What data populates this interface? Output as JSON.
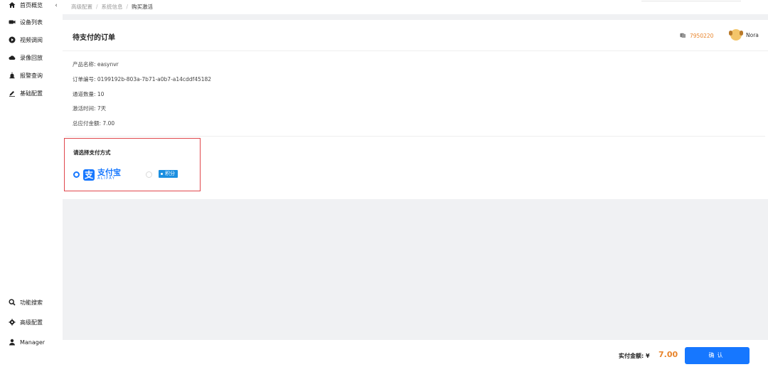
{
  "sidebar": {
    "collapse_icon": "chevron-left-icon",
    "items": [
      {
        "label": "首页概览",
        "icon": "home-icon"
      },
      {
        "label": "设备列表",
        "icon": "camera-icon"
      },
      {
        "label": "视频调阅",
        "icon": "play-icon"
      },
      {
        "label": "录像回放",
        "icon": "cloud-icon"
      },
      {
        "label": "报警查询",
        "icon": "alarm-icon"
      },
      {
        "label": "基础配置",
        "icon": "edit-icon"
      }
    ],
    "bottom_items": [
      {
        "label": "功能搜索",
        "icon": "search-icon"
      },
      {
        "label": "高级配置",
        "icon": "gear-icon"
      },
      {
        "label": "Manager",
        "icon": "user-icon"
      }
    ]
  },
  "breadcrumb": [
    "高级配置",
    "系统信息",
    "购买激活"
  ],
  "header": {
    "title": "待支付的订单",
    "points": "7950220",
    "user": "Nora"
  },
  "order": {
    "rows": [
      "产品名称: easynvr",
      "订单编号: 0199192b-803a-7b71-a0b7-a14cddf45182",
      "通道数量: 10",
      "激活时间: 7天",
      "总应付金额: 7.00"
    ]
  },
  "payment": {
    "title": "请选择支付方式",
    "alipay_cn": "支付宝",
    "alipay_en": "ALIPAY",
    "alipay_mark": "支",
    "points_tag": "积分",
    "selected": "alipay"
  },
  "footer": {
    "total_label": "实付金额: ¥",
    "total_amount": "7.00",
    "confirm_label": "确认"
  },
  "colors": {
    "accent": "#1677ff",
    "price": "#e8842b",
    "highlight_border": "#e0474c"
  }
}
